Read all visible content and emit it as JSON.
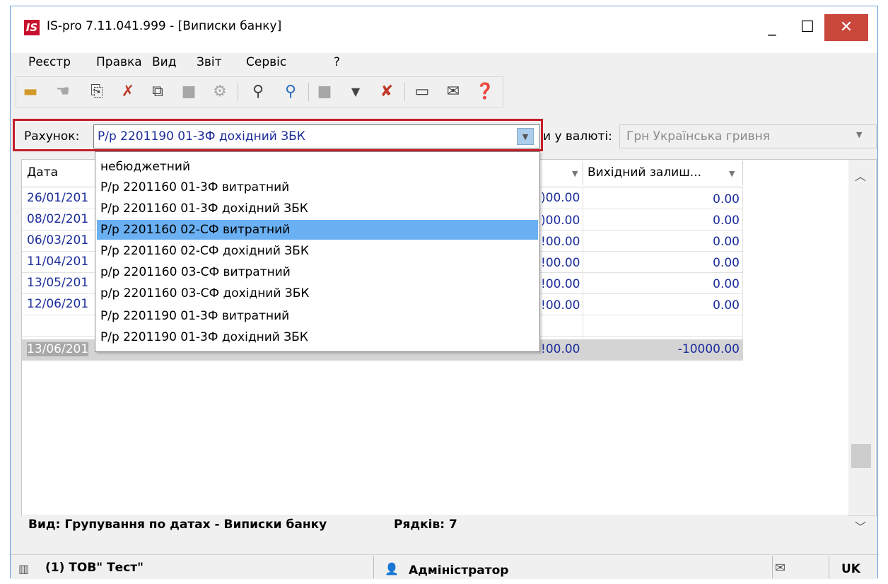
{
  "window": {
    "logo": "IS",
    "title": "IS-pro 7.11.041.999 - [Виписки банку]",
    "controls": {
      "minimize": "_",
      "maximize": "☐",
      "close": "✕"
    }
  },
  "menu": {
    "items": [
      "Реєстр",
      "Правка",
      "Вид",
      "Звіт",
      "Сервіс",
      "?"
    ]
  },
  "toolbar": {
    "icons": [
      "open-folder-icon",
      "pointer-icon",
      "add-document-icon",
      "delete-document-icon",
      "copy-icon",
      "disabled-icon",
      "settings-icon",
      "search-icon",
      "search-next-icon",
      "disabled-block-icon",
      "filter-icon",
      "clear-filter-icon",
      "form-icon",
      "mail-icon",
      "help-icon"
    ]
  },
  "account": {
    "label": "Рахунок:",
    "value": "Р/р 2201190 01-3Ф дохідний ЗБК"
  },
  "currency": {
    "label": "и у валюті:",
    "value": "Грн Українська гривня"
  },
  "grid": {
    "headers": {
      "date": "Дата",
      "closing_balance": "Вихідний залиш..."
    },
    "rows": [
      {
        "date": "26/01/201",
        "col_a": ")00.00",
        "col_b": "0.00"
      },
      {
        "date": "08/02/201",
        "col_a": ")00.00",
        "col_b": "0.00"
      },
      {
        "date": "06/03/201",
        "col_a": "!00.00",
        "col_b": "0.00"
      },
      {
        "date": "11/04/201",
        "col_a": "!00.00",
        "col_b": "0.00"
      },
      {
        "date": "13/05/201",
        "col_a": "!00.00",
        "col_b": "0.00"
      },
      {
        "date": "12/06/201",
        "col_a": "!00.00",
        "col_b": "0.00"
      },
      {
        "date": "13/06/201",
        "col_a": "!00.00",
        "col_b": "-10000.00"
      }
    ]
  },
  "dropdown": {
    "items": [
      "небюджетний",
      "Р/р 2201160 01-3Ф витратний",
      "Р/р 2201160 01-3Ф дохідний ЗБК",
      "Р/р 2201160 02-СФ витратний",
      "Р/р 2201160 02-СФ дохідний ЗБК",
      "р/р 2201160 03-СФ витратний",
      "р/р 2201160 03-СФ дохідний ЗБК",
      "Р/р 2201190 01-3Ф витратний",
      "Р/р 2201190 01-3Ф дохідний ЗБК"
    ],
    "selected_index": 3
  },
  "footer": {
    "view": "Вид: Групування по датах - Виписки банку",
    "rows": "Рядків: 7"
  },
  "status": {
    "org": "(1) ТОВ\" Тест\"",
    "user": "Адміністратор",
    "lang": "UK"
  }
}
